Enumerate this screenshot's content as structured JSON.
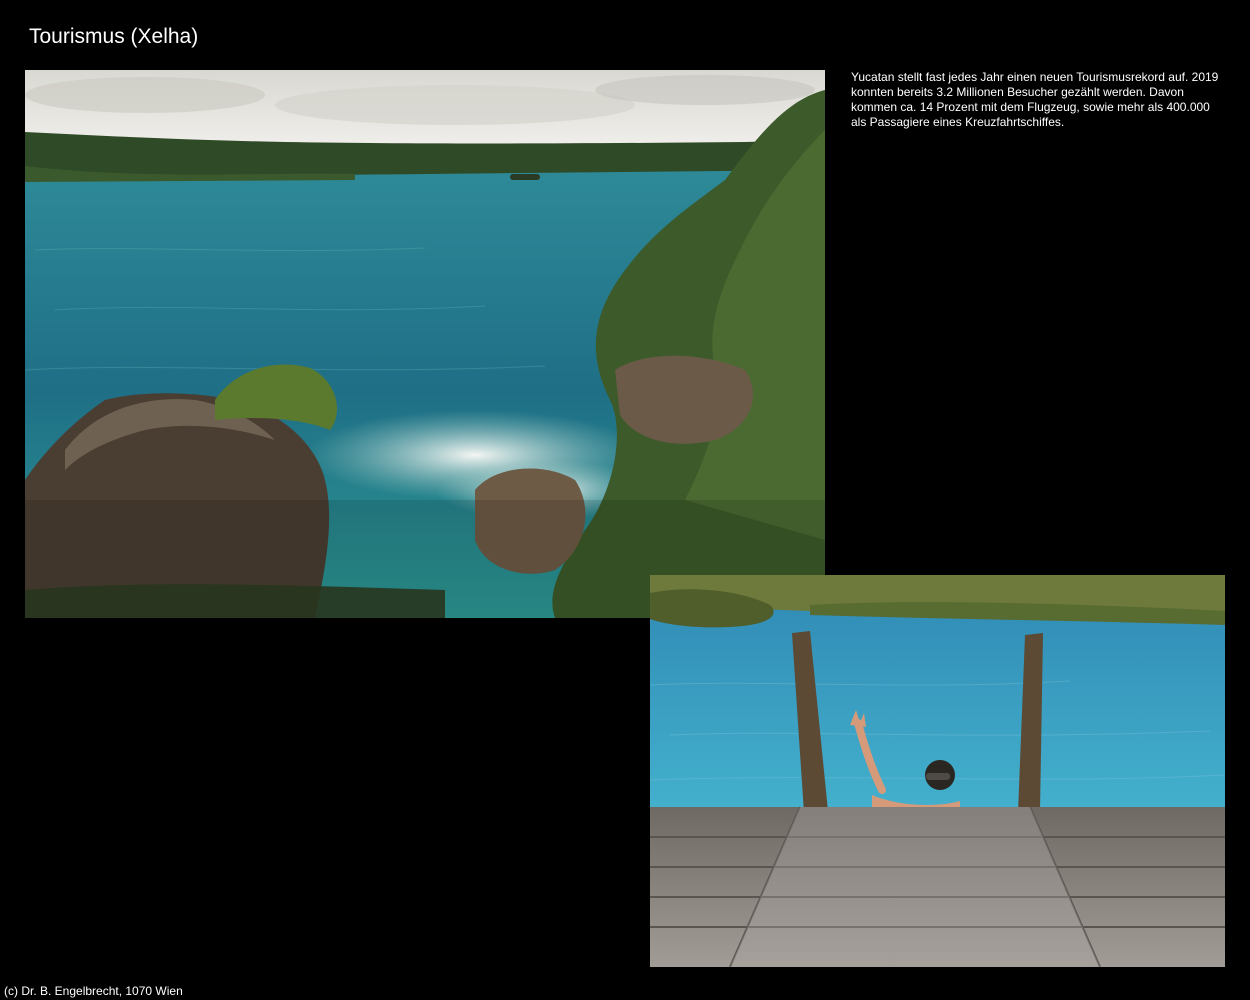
{
  "page": {
    "title": "Tourismus (Xelha)",
    "description": "Yucatan stellt fast jedes Jahr einen neuen Tourismusrekord auf. 2019 konnten bereits 3.2 Millionen Besucher gezählt werden. Davon kommen ca. 14 Prozent mit dem Flugzeug, sowie mehr als 400.000 als Passagiere eines Kreuzfahrtschiffes.",
    "footer": "(c) Dr. B. Engelbrecht, 1070 Wien",
    "background_color": "#000000",
    "text_color": "#ffffff"
  },
  "photos": [
    {
      "name": "lagoon-rocks-photo",
      "colors": {
        "sky": "#e7e6e1",
        "water": "#2f8f9a",
        "water_deep": "#1f6f86",
        "foliage": "#3f5a2c",
        "rock": "#5a4a3a",
        "surf": "#e8eeec"
      }
    },
    {
      "name": "dock-swimmer-photo",
      "colors": {
        "water": "#3aa8c6",
        "shore": "#6e7a3c",
        "dock": "#8f8a86",
        "post": "#5c4a35",
        "skin": "#d59a7a"
      }
    }
  ]
}
